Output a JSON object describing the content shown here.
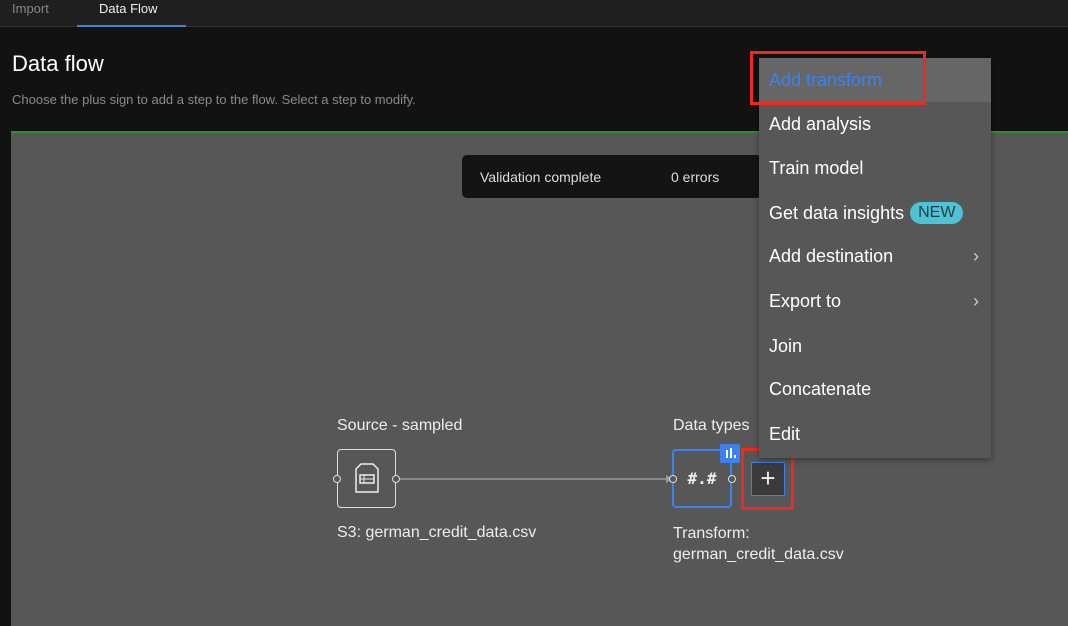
{
  "tabs": [
    {
      "label": "Import"
    },
    {
      "label": "Data Flow"
    }
  ],
  "header": {
    "title": "Data flow",
    "subtitle": "Choose the plus sign to add a step to the flow. Select a step to modify."
  },
  "toast": {
    "status": "Validation complete",
    "errors": "0 errors"
  },
  "nodes": {
    "source": {
      "title": "Source - sampled",
      "caption": "S3: german_credit_data.csv",
      "icon": "document-table-icon"
    },
    "transform": {
      "title": "Data types",
      "glyph": "#.#",
      "caption_line1": "Transform:",
      "caption_line2": "german_credit_data.csv",
      "icon": "bar-chart-icon"
    },
    "add": {
      "glyph": "+"
    }
  },
  "menu": {
    "items": [
      {
        "label": "Add transform"
      },
      {
        "label": "Add analysis"
      },
      {
        "label": "Train model"
      },
      {
        "label": "Get data insights",
        "badge": "NEW"
      },
      {
        "label": "Add destination",
        "submenu": true
      },
      {
        "label": "Export to",
        "submenu": true
      },
      {
        "label": "Join"
      },
      {
        "label": "Concatenate"
      },
      {
        "label": "Edit"
      }
    ]
  },
  "colors": {
    "accent": "#3b82f0",
    "highlight": "#f0281e",
    "badge": "#4bc4d6",
    "canvas": "#575757"
  }
}
